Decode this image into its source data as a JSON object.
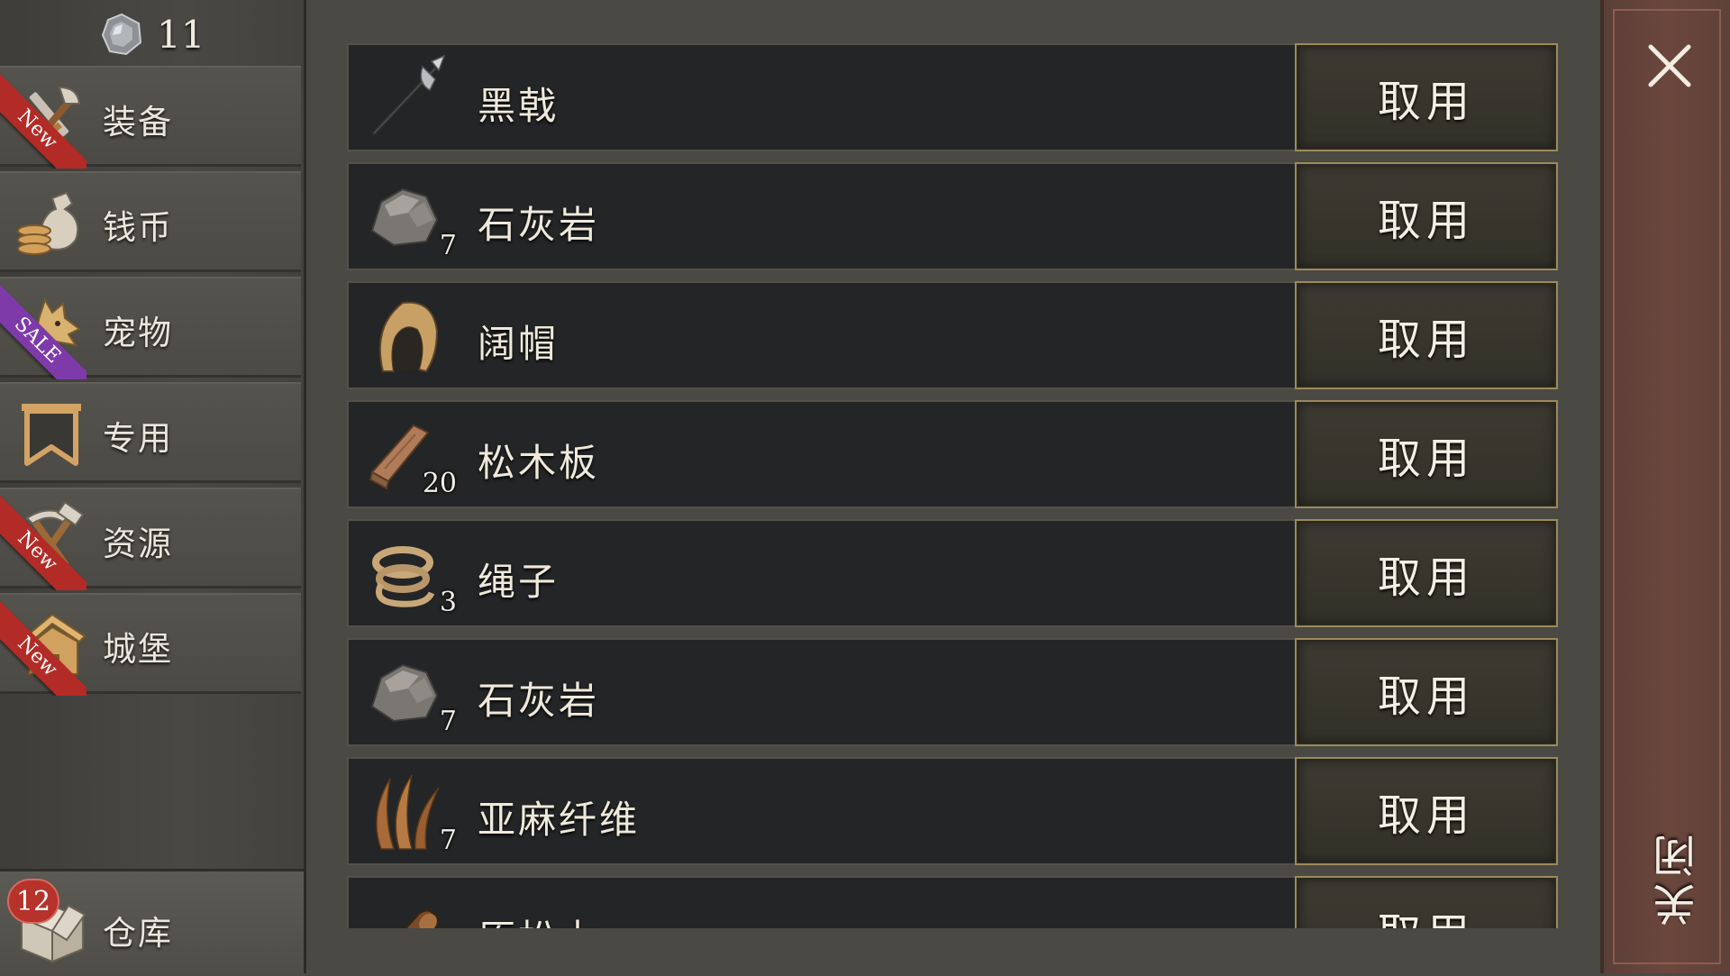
{
  "currency": {
    "icon": "silver-gem-icon",
    "count": "11"
  },
  "sidebar": {
    "items": [
      {
        "label": "装备",
        "icon": "sword-axe-icon",
        "ribbon": "New"
      },
      {
        "label": "钱币",
        "icon": "coin-bag-icon",
        "ribbon": ""
      },
      {
        "label": "宠物",
        "icon": "wolf-icon",
        "ribbon": "SALE"
      },
      {
        "label": "专用",
        "icon": "bookmark-icon",
        "ribbon": ""
      },
      {
        "label": "资源",
        "icon": "hammer-pickaxe-icon",
        "ribbon": "New"
      },
      {
        "label": "城堡",
        "icon": "house-icon",
        "ribbon": "New"
      }
    ],
    "storage": {
      "label": "仓库",
      "icon": "crate-icon",
      "badge": "12"
    }
  },
  "items": [
    {
      "name": "黑戟",
      "icon": "halberd-icon",
      "qty": "",
      "action": "取用"
    },
    {
      "name": "石灰岩",
      "icon": "rock-icon",
      "qty": "7",
      "action": "取用"
    },
    {
      "name": "阔帽",
      "icon": "hood-icon",
      "qty": "",
      "action": "取用"
    },
    {
      "name": "松木板",
      "icon": "plank-icon",
      "qty": "20",
      "action": "取用"
    },
    {
      "name": "绳子",
      "icon": "rope-icon",
      "qty": "3",
      "action": "取用"
    },
    {
      "name": "石灰岩",
      "icon": "rock-icon",
      "qty": "7",
      "action": "取用"
    },
    {
      "name": "亚麻纤维",
      "icon": "flax-icon",
      "qty": "7",
      "action": "取用"
    },
    {
      "name": "原松木",
      "icon": "log-icon",
      "qty": "",
      "action": "取用"
    }
  ],
  "close": {
    "label": "关闭",
    "icon": "close-icon"
  },
  "colors": {
    "ribbon_new": "#b32b26",
    "ribbon_sale": "#7d3aa8",
    "button_border": "#9c8a5a",
    "close_panel": "#6b463d"
  }
}
